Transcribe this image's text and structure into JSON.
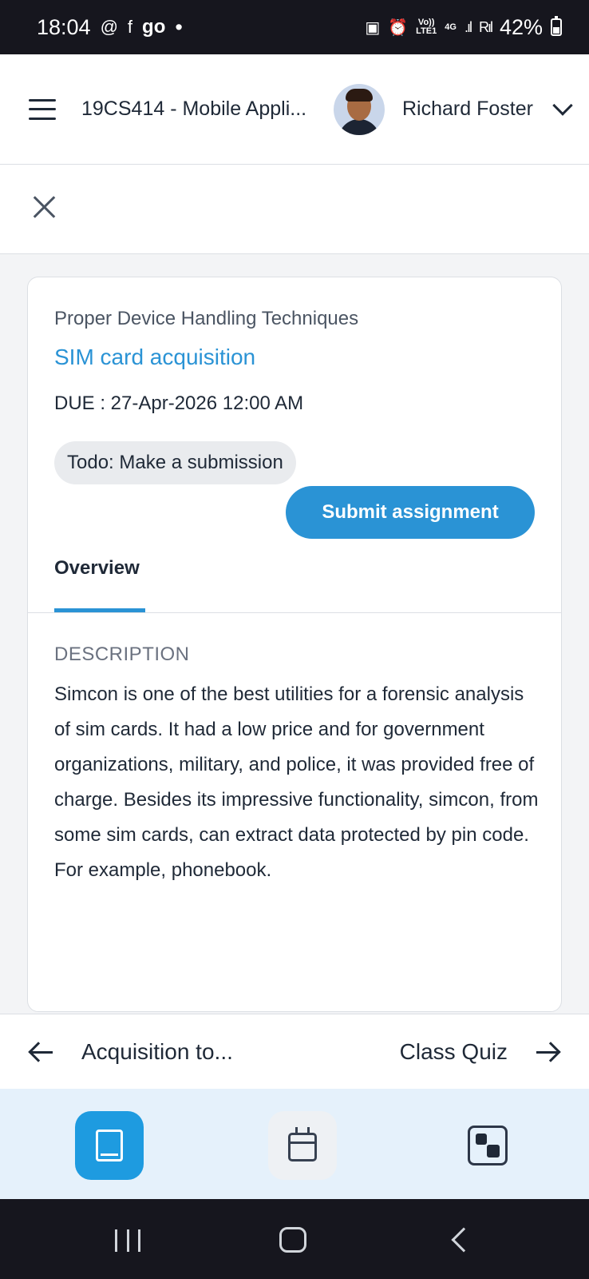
{
  "status_bar": {
    "time": "18:04",
    "app_icons": [
      "threads-icon",
      "facebook-icon"
    ],
    "go_label": "go",
    "dot": "•",
    "network_top": "Vo))",
    "network_bottom": "LTE1",
    "network_type": "4G",
    "battery": "42%"
  },
  "header": {
    "course_title": "19CS414 - Mobile Appli...",
    "user_name": "Richard Foster"
  },
  "assignment": {
    "section": "Proper Device Handling Techniques",
    "title": "SIM card acquisition",
    "due": "DUE : 27-Apr-2026 12:00 AM",
    "todo": "Todo: Make a submission",
    "submit_label": "Submit assignment"
  },
  "tabs": {
    "overview": "Overview"
  },
  "description": {
    "heading": "DESCRIPTION",
    "text": "Simcon is one of the best utilities for a forensic analysis of sim cards. It had a low price and for government organizations, military, and police, it was provided free of charge. Besides its impressive functionality, simcon, from some sim cards, can extract data protected by pin code. For example, phonebook."
  },
  "pager": {
    "previous": "Acquisition to...",
    "next": "Class Quiz"
  },
  "bottom_nav": {
    "items": [
      {
        "icon": "book-icon",
        "active": true
      },
      {
        "icon": "calendar-icon",
        "active": false
      },
      {
        "icon": "dashboard-icon",
        "active": false
      }
    ]
  },
  "colors": {
    "accent": "#2a93d5",
    "active_nav": "#1e9be0",
    "nav_background": "#e5f1fb",
    "status_bar": "#16161e"
  }
}
